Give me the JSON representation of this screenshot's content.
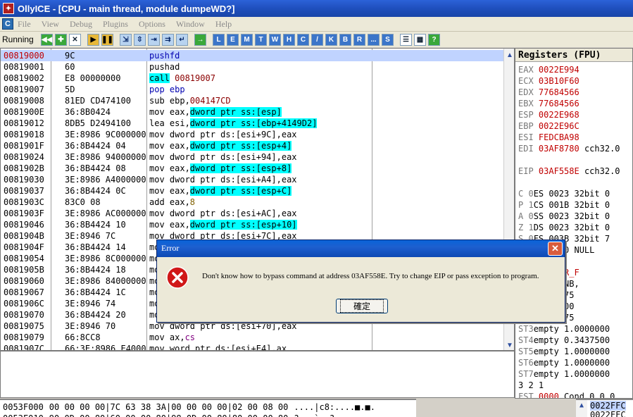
{
  "window": {
    "title": "OllyICE - [CPU - main thread, module dumpeWD?]",
    "app_icon": "olly-app-icon"
  },
  "menu": {
    "items": [
      "File",
      "View",
      "Debug",
      "Plugins",
      "Options",
      "Window",
      "Help"
    ]
  },
  "toolbar": {
    "status": "Running",
    "letter_buttons": [
      "L",
      "E",
      "M",
      "T",
      "W",
      "H",
      "C",
      "/",
      "K",
      "B",
      "R",
      "...",
      "S"
    ]
  },
  "disasm": {
    "rows": [
      {
        "addr": "00819000",
        "hex": "9C",
        "cmd": [
          {
            "t": "pushfd",
            "c": "blue"
          }
        ],
        "selected": true
      },
      {
        "addr": "00819001",
        "hex": "60",
        "cmd": [
          {
            "t": "pushad",
            "c": ""
          }
        ]
      },
      {
        "addr": "00819002",
        "hex": "E8 00000000",
        "cmd": [
          {
            "t": "call",
            "c": "cyan"
          },
          {
            "t": " 00819007",
            "c": "darkred"
          }
        ]
      },
      {
        "addr": "00819007",
        "hex": "5D",
        "cmd": [
          {
            "t": "pop ebp",
            "c": "blue"
          }
        ]
      },
      {
        "addr": "00819008",
        "hex": "81ED CD474100",
        "cmd": [
          {
            "t": "sub ebp,",
            "c": ""
          },
          {
            "t": "004147CD",
            "c": "darkred"
          }
        ]
      },
      {
        "addr": "0081900E",
        "hex": "36:8B0424",
        "cmd": [
          {
            "t": "mov eax,",
            "c": ""
          },
          {
            "t": "dword ptr ss:[esp]",
            "c": "cyan"
          }
        ]
      },
      {
        "addr": "00819012",
        "hex": "8DB5 D2494100",
        "cmd": [
          {
            "t": "lea esi,",
            "c": ""
          },
          {
            "t": "dword ptr ss:[ebp+4149D2]",
            "c": "cyan"
          }
        ]
      },
      {
        "addr": "00819018",
        "hex": "3E:8986 9C000000",
        "cmd": [
          {
            "t": "mov dword ptr ds:[esi+9C],eax",
            "c": ""
          }
        ]
      },
      {
        "addr": "0081901F",
        "hex": "36:8B4424 04",
        "cmd": [
          {
            "t": "mov eax,",
            "c": ""
          },
          {
            "t": "dword ptr ss:[esp+4]",
            "c": "cyan"
          }
        ]
      },
      {
        "addr": "00819024",
        "hex": "3E:8986 94000000",
        "cmd": [
          {
            "t": "mov dword ptr ds:[esi+94],eax",
            "c": ""
          }
        ]
      },
      {
        "addr": "0081902B",
        "hex": "36:8B4424 08",
        "cmd": [
          {
            "t": "mov eax,",
            "c": ""
          },
          {
            "t": "dword ptr ss:[esp+8]",
            "c": "cyan"
          }
        ]
      },
      {
        "addr": "00819030",
        "hex": "3E:8986 A4000000",
        "cmd": [
          {
            "t": "mov dword ptr ds:[esi+A4],eax",
            "c": ""
          }
        ]
      },
      {
        "addr": "00819037",
        "hex": "36:8B4424 0C",
        "cmd": [
          {
            "t": "mov eax,",
            "c": ""
          },
          {
            "t": "dword ptr ss:[esp+C]",
            "c": "cyan"
          }
        ]
      },
      {
        "addr": "0081903C",
        "hex": "83C0 08",
        "cmd": [
          {
            "t": "add eax,",
            "c": ""
          },
          {
            "t": "8",
            "c": "olive"
          }
        ]
      },
      {
        "addr": "0081903F",
        "hex": "3E:8986 AC000000",
        "cmd": [
          {
            "t": "mov dword ptr ds:[esi+AC],eax",
            "c": ""
          }
        ]
      },
      {
        "addr": "00819046",
        "hex": "36:8B4424 10",
        "cmd": [
          {
            "t": "mov eax,",
            "c": ""
          },
          {
            "t": "dword ptr ss:[esp+10]",
            "c": "cyan"
          }
        ]
      },
      {
        "addr": "0081904B",
        "hex": "3E:8946 7C",
        "cmd": [
          {
            "t": "mov dword ptr ds:[esi+7C],eax",
            "c": ""
          }
        ]
      },
      {
        "addr": "0081904F",
        "hex": "36:8B4424 14",
        "cmd": [
          {
            "t": "mo",
            "c": ""
          }
        ]
      },
      {
        "addr": "00819054",
        "hex": "3E:8986 8C000000",
        "cmd": [
          {
            "t": "mo",
            "c": ""
          }
        ]
      },
      {
        "addr": "0081905B",
        "hex": "36:8B4424 18",
        "cmd": [
          {
            "t": "mo",
            "c": ""
          }
        ]
      },
      {
        "addr": "00819060",
        "hex": "3E:8986 84000000",
        "cmd": [
          {
            "t": "mo",
            "c": ""
          }
        ]
      },
      {
        "addr": "00819067",
        "hex": "36:8B4424 1C",
        "cmd": [
          {
            "t": "mo",
            "c": ""
          }
        ]
      },
      {
        "addr": "0081906C",
        "hex": "3E:8946 74",
        "cmd": [
          {
            "t": "mo",
            "c": ""
          }
        ]
      },
      {
        "addr": "00819070",
        "hex": "36:8B4424 20",
        "cmd": [
          {
            "t": "mo",
            "c": ""
          }
        ]
      },
      {
        "addr": "00819075",
        "hex": "3E:8946 70",
        "cmd": [
          {
            "t": "mov dword ptr ds:[esi+70],eax",
            "c": ""
          }
        ]
      },
      {
        "addr": "00819079",
        "hex": "66:8CC8",
        "cmd": [
          {
            "t": "mov ax,",
            "c": ""
          },
          {
            "t": "cs",
            "c": "purple"
          }
        ]
      },
      {
        "addr": "0081907C",
        "hex": "66:3E:8986 E4000000",
        "cmd": [
          {
            "t": "mov word ptr ds:[esi+E4],ax",
            "c": ""
          }
        ]
      }
    ]
  },
  "registers": {
    "header": "Registers (FPU)",
    "rows": [
      {
        "name": "EAX",
        "val": "0022E994",
        "extra": ""
      },
      {
        "name": "ECX",
        "val": "03B10F60",
        "extra": ""
      },
      {
        "name": "EDX",
        "val": "77684566",
        "extra": ""
      },
      {
        "name": "EBX",
        "val": "77684566",
        "extra": ""
      },
      {
        "name": "ESP",
        "val": "0022E968",
        "extra": ""
      },
      {
        "name": "EBP",
        "val": "0022E96C",
        "extra": ""
      },
      {
        "name": "ESI",
        "val": "FEDCBA98",
        "extra": ""
      },
      {
        "name": "EDI",
        "val": "03AF8780",
        "extra": " cch32.0"
      },
      {
        "name": "",
        "val": "",
        "extra": ""
      },
      {
        "name": "EIP",
        "val": "03AF558E",
        "extra": " cch32.0"
      },
      {
        "name": "",
        "val": "",
        "extra": ""
      },
      {
        "name": "C 0",
        "val": "",
        "extra": "ES 0023 32bit 0"
      },
      {
        "name": "P 1",
        "val": "",
        "extra": "CS 001B 32bit 0"
      },
      {
        "name": "A 0",
        "val": "",
        "extra": "SS 0023 32bit 0"
      },
      {
        "name": "Z 1",
        "val": "",
        "extra": "DS 0023 32bit 0"
      },
      {
        "name": "S 0",
        "val": "",
        "extra": "FS 003B 32bit 7"
      },
      {
        "name": "T 0",
        "val": "",
        "extra": "GS 0000 NULL"
      },
      {
        "name": "",
        "val": "",
        "extra": ""
      },
      {
        "name": "",
        "val": "",
        "extra": "tErr ERROR_F"
      },
      {
        "name": "",
        "val": "0246",
        "extra": " (NO,NB,"
      },
      {
        "name": "",
        "val": "",
        "extra": "y 0.3671875"
      },
      {
        "name": "",
        "val": "",
        "extra": "y 16.000000"
      },
      {
        "name": "",
        "val": "",
        "extra": "y 0.3671875"
      },
      {
        "name": "ST3",
        "val": "",
        "extra": "empty 1.0000000"
      },
      {
        "name": "ST4",
        "val": "",
        "extra": "empty 0.3437500"
      },
      {
        "name": "ST5",
        "val": "",
        "extra": "empty 1.0000000"
      },
      {
        "name": "ST6",
        "val": "",
        "extra": "empty 1.0000000"
      },
      {
        "name": "ST7",
        "val": "",
        "extra": "empty 1.0000000"
      },
      {
        "name": "",
        "val": "",
        "extra": "           3 2 1"
      },
      {
        "name": "FST",
        "val": "0000",
        "extra": "  Cond 0 0 0"
      }
    ]
  },
  "dump": {
    "rows": [
      {
        "addr": "0053F000",
        "hex": "00 00 00 00|7C 63 38 3A|00 00 00 00|02 00 08 00",
        "ascii": "....|c8:....■.■."
      },
      {
        "addr": "0053F010",
        "hex": "90 0D 00 80|60 00 00 80|98 0D 00 80|80 00 00 80",
        "ascii": "?.. `..?..."
      }
    ]
  },
  "stack": {
    "rows": [
      "0022FFC",
      "0022FFC"
    ]
  },
  "dialog": {
    "title": "Error",
    "message": "Don't know how to bypass command at address 03AF558E. Try to change EIP or pass exception to program.",
    "ok_label": "確定"
  }
}
